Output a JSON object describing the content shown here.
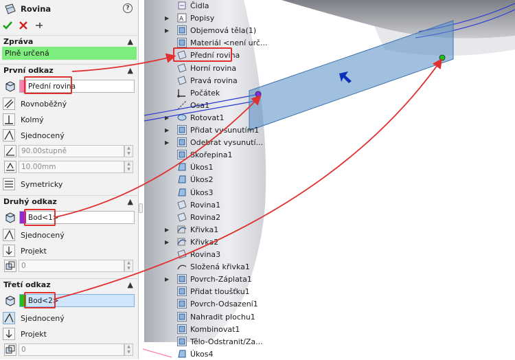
{
  "pm": {
    "title": "Rovina",
    "help": "?",
    "message_header": "Zpráva",
    "message": "Plně určená",
    "ref1": {
      "header": "První odkaz",
      "selection": "Přední rovina",
      "swatch": "#ff7fb0",
      "options": [
        "Rovnoběžný",
        "Kolmý",
        "Sjednocený"
      ],
      "angle": "90.00stupně",
      "distance": "10.00mm",
      "symmetric": "Symetricky"
    },
    "ref2": {
      "header": "Druhý odkaz",
      "selection": "Bod<1>",
      "swatch": "#8a2be2",
      "options": [
        "Sjednocený",
        "Projekt"
      ],
      "count": "0"
    },
    "ref3": {
      "header": "Třetí odkaz",
      "selection": "Bod<2>",
      "swatch": "#19c419",
      "options": [
        "Sjednocený",
        "Projekt"
      ],
      "count": "0"
    }
  },
  "tree": {
    "items": [
      {
        "label": "Čidla",
        "icon": "sensor-icon",
        "expand": false
      },
      {
        "label": "Popisy",
        "icon": "annotations-icon",
        "expand": true
      },
      {
        "label": "Objemová těla(1)",
        "icon": "solid-bodies-icon",
        "expand": true
      },
      {
        "label": "Materiál <není urč...",
        "icon": "material-icon",
        "expand": false
      },
      {
        "label": "Přední rovina",
        "icon": "plane-icon",
        "expand": false
      },
      {
        "label": "Horní rovina",
        "icon": "plane-icon",
        "expand": false
      },
      {
        "label": "Pravá rovina",
        "icon": "plane-icon",
        "expand": false
      },
      {
        "label": "Počátek",
        "icon": "origin-icon",
        "expand": false
      },
      {
        "label": "Osa1",
        "icon": "axis-icon",
        "expand": false
      },
      {
        "label": "Rotovat1",
        "icon": "revolve-icon",
        "expand": true
      },
      {
        "label": "Přidat vysunutím1",
        "icon": "extrude-icon",
        "expand": true
      },
      {
        "label": "Odebrat vysunutí...",
        "icon": "cut-extrude-icon",
        "expand": true
      },
      {
        "label": "Skořepina1",
        "icon": "shell-icon",
        "expand": false
      },
      {
        "label": "Úkos1",
        "icon": "draft-icon",
        "expand": false
      },
      {
        "label": "Úkos2",
        "icon": "draft-icon",
        "expand": false
      },
      {
        "label": "Úkos3",
        "icon": "draft-icon",
        "expand": false
      },
      {
        "label": "Rovina1",
        "icon": "plane-icon",
        "expand": false
      },
      {
        "label": "Rovina2",
        "icon": "plane-icon",
        "expand": false
      },
      {
        "label": "Křivka1",
        "icon": "curve-icon",
        "expand": true
      },
      {
        "label": "Křivka2",
        "icon": "curve-icon",
        "expand": true
      },
      {
        "label": "Rovina3",
        "icon": "plane-icon",
        "expand": false
      },
      {
        "label": "Složená křivka1",
        "icon": "composite-curve-icon",
        "expand": false
      },
      {
        "label": "Povrch-Záplata1",
        "icon": "surface-fill-icon",
        "expand": true
      },
      {
        "label": "Přidat tloušťku1",
        "icon": "thicken-icon",
        "expand": false
      },
      {
        "label": "Povrch-Odsazení1",
        "icon": "offset-surface-icon",
        "expand": false
      },
      {
        "label": "Nahradit plochu1",
        "icon": "replace-face-icon",
        "expand": false
      },
      {
        "label": "Kombinovat1",
        "icon": "combine-icon",
        "expand": false
      },
      {
        "label": "Tělo-Odstranit/Za...",
        "icon": "delete-body-icon",
        "expand": false
      },
      {
        "label": "Úkos4",
        "icon": "draft-icon",
        "expand": false
      }
    ]
  },
  "colors": {
    "plane_fill": "#5d90c6",
    "annotation": "#e03030",
    "message_bg": "#7dee7d"
  }
}
